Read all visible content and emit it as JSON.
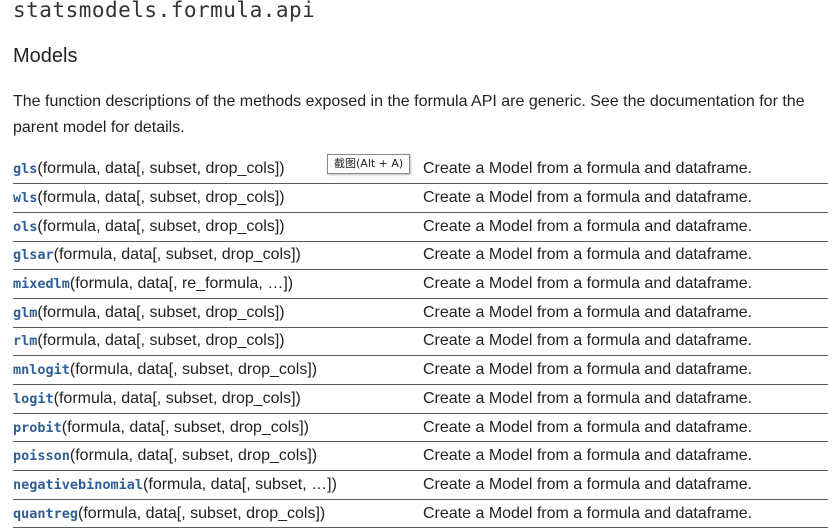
{
  "module_title": "statsmodels.formula.api",
  "section_heading": "Models",
  "intro_text": "The function descriptions of the methods exposed in the formula API are generic. See the documentation for the parent model for details.",
  "tooltip": "截图(Alt + A)",
  "rows": [
    {
      "name": "gls",
      "args": "(formula, data[, subset, drop_cols])",
      "desc": "Create a Model from a formula and dataframe."
    },
    {
      "name": "wls",
      "args": "(formula, data[, subset, drop_cols])",
      "desc": "Create a Model from a formula and dataframe."
    },
    {
      "name": "ols",
      "args": "(formula, data[, subset, drop_cols])",
      "desc": "Create a Model from a formula and dataframe."
    },
    {
      "name": "glsar",
      "args": "(formula, data[, subset, drop_cols])",
      "desc": "Create a Model from a formula and dataframe."
    },
    {
      "name": "mixedlm",
      "args": "(formula, data[, re_formula, …])",
      "desc": "Create a Model from a formula and dataframe."
    },
    {
      "name": "glm",
      "args": "(formula, data[, subset, drop_cols])",
      "desc": "Create a Model from a formula and dataframe."
    },
    {
      "name": "rlm",
      "args": "(formula, data[, subset, drop_cols])",
      "desc": "Create a Model from a formula and dataframe."
    },
    {
      "name": "mnlogit",
      "args": "(formula, data[, subset, drop_cols])",
      "desc": "Create a Model from a formula and dataframe."
    },
    {
      "name": "logit",
      "args": "(formula, data[, subset, drop_cols])",
      "desc": "Create a Model from a formula and dataframe."
    },
    {
      "name": "probit",
      "args": "(formula, data[, subset, drop_cols])",
      "desc": "Create a Model from a formula and dataframe."
    },
    {
      "name": "poisson",
      "args": "(formula, data[, subset, drop_cols])",
      "desc": "Create a Model from a formula and dataframe."
    },
    {
      "name": "negativebinomial",
      "args": "(formula, data[, subset, …])",
      "desc": "Create a Model from a formula and dataframe."
    },
    {
      "name": "quantreg",
      "args": "(formula, data[, subset, drop_cols])",
      "desc": "Create a Model from a formula and dataframe."
    }
  ],
  "colors": {
    "link": "#2f5f96",
    "text": "#222222",
    "row_border": "#5a5a5a"
  }
}
